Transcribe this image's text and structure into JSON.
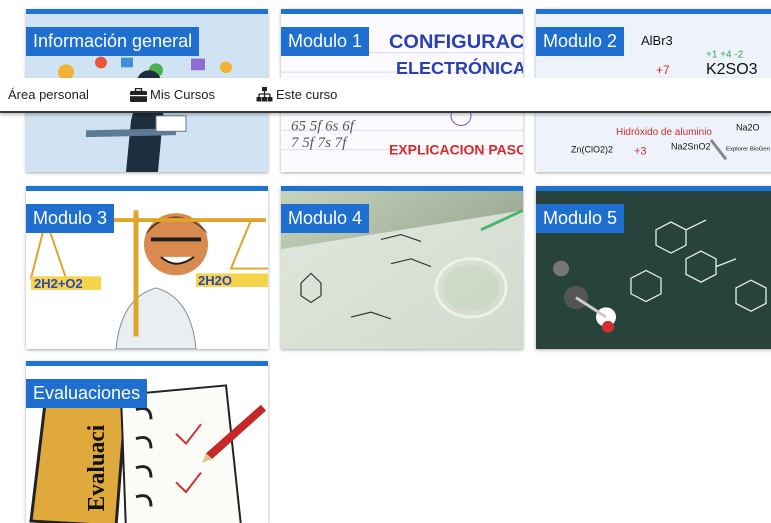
{
  "breadcrumb": {
    "home_label": "Área personal",
    "courses_label": "Mis Cursos",
    "course_label": "Este curso"
  },
  "sections": [
    {
      "label": "Información general"
    },
    {
      "label": "Modulo 1",
      "art_text_top": "CONFIGURACIÓN",
      "art_text_mid": "ELECTRÓNICA",
      "art_text_bottom": "EXPLICACION PASO A PAS"
    },
    {
      "label": "Modulo 2",
      "art_text_1": "AlBr3",
      "art_text_2": "K2SO3",
      "art_text_3": "Hidróxido de aluminio",
      "art_text_4": "Zn(ClO2)2",
      "art_text_5": "Na2SnO2",
      "art_text_6": "Explorer BioGen",
      "art_text_7": "+3",
      "art_text_8": "+7",
      "art_text_9": "+1 +4 -2",
      "art_text_10": "Na2O"
    },
    {
      "label": "Modulo 3",
      "art_text_left": "2H2+O2",
      "art_text_right": "2H2O"
    },
    {
      "label": "Modulo 4"
    },
    {
      "label": "Modulo 5"
    },
    {
      "label": "Evaluaciones",
      "art_text": "Evaluaci"
    }
  ],
  "colors": {
    "accent": "#1e73d1",
    "label_bg": "#1f6fd0"
  }
}
